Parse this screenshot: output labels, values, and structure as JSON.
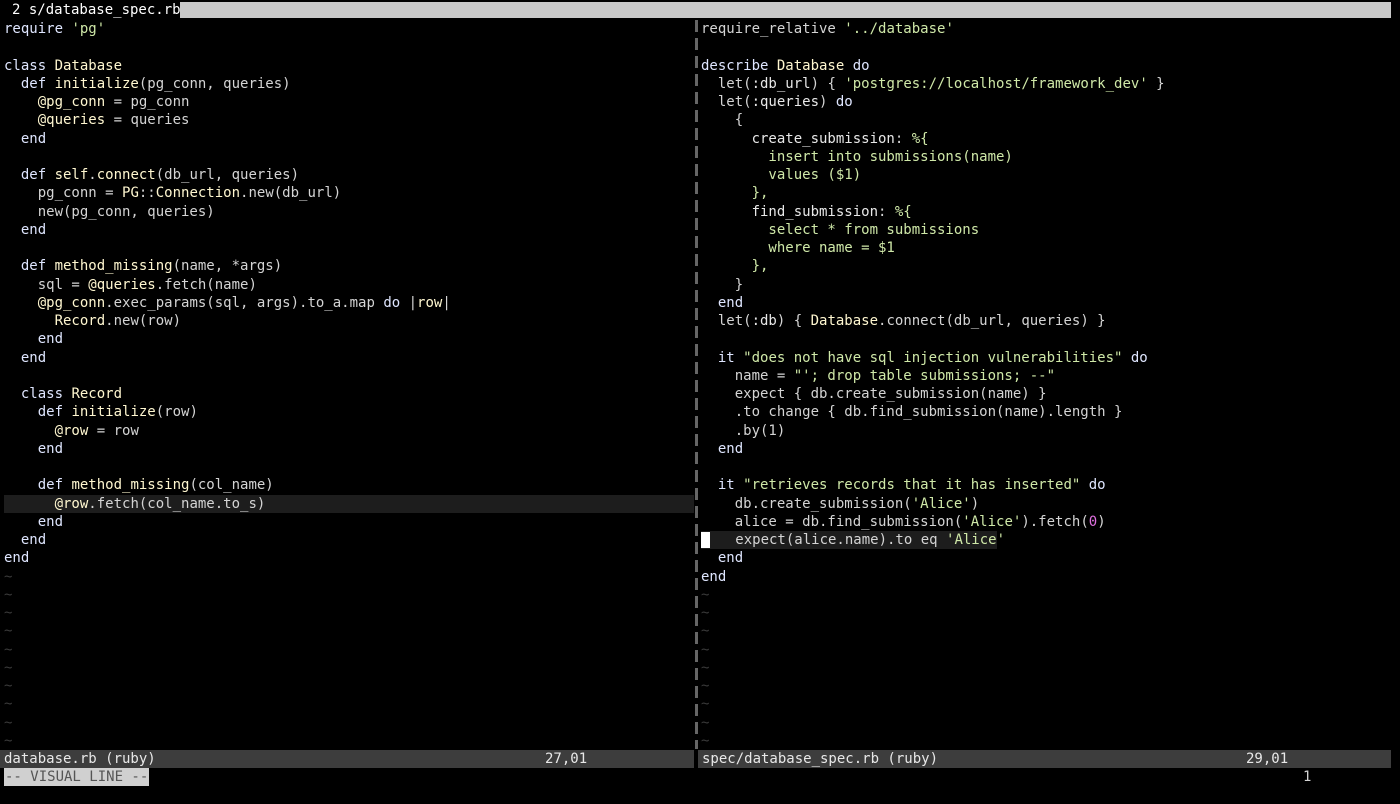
{
  "tabline": {
    "active_tab": "2 s/database_spec.rb"
  },
  "colors": {
    "background": "#000000",
    "text": "#d4d4d4",
    "keyword": "#dfe6ff",
    "name": "#fff7d0",
    "string": "#cfe8a8",
    "symbol": "#e8e8e8",
    "number": "#e070e0",
    "tilde": "#3a3a3a",
    "statusline": "#3d3d3d",
    "cursorline": "#1d1d1d"
  },
  "left_pane": {
    "lines": [
      [
        [
          "require ",
          "k"
        ],
        [
          "'pg'",
          "s"
        ]
      ],
      [],
      [
        [
          "class ",
          "k"
        ],
        [
          "Database",
          "n"
        ]
      ],
      [
        [
          "  def ",
          "k"
        ],
        [
          "initialize",
          "n"
        ],
        [
          "(pg_conn, queries)",
          "t"
        ]
      ],
      [
        [
          "    @pg_conn",
          "n"
        ],
        [
          " = pg_conn",
          "t"
        ]
      ],
      [
        [
          "    @queries",
          "n"
        ],
        [
          " = queries",
          "t"
        ]
      ],
      [
        [
          "  end",
          "k"
        ]
      ],
      [],
      [
        [
          "  def ",
          "k"
        ],
        [
          "self",
          "n"
        ],
        [
          ".",
          "t"
        ],
        [
          "connect",
          "n"
        ],
        [
          "(db_url, queries)",
          "t"
        ]
      ],
      [
        [
          "    pg_conn = ",
          "t"
        ],
        [
          "PG",
          "n"
        ],
        [
          "::",
          "t"
        ],
        [
          "Connection",
          "n"
        ],
        [
          ".new(db_url)",
          "t"
        ]
      ],
      [
        [
          "    new(pg_conn, queries)",
          "t"
        ]
      ],
      [
        [
          "  end",
          "k"
        ]
      ],
      [],
      [
        [
          "  def ",
          "k"
        ],
        [
          "method_missing",
          "n"
        ],
        [
          "(name, *args)",
          "t"
        ]
      ],
      [
        [
          "    sql = ",
          "t"
        ],
        [
          "@queries",
          "n"
        ],
        [
          ".fetch(name)",
          "t"
        ]
      ],
      [
        [
          "    @pg_conn",
          "n"
        ],
        [
          ".exec_params(sql, args).to_a.map ",
          "t"
        ],
        [
          "do",
          "k"
        ],
        [
          " |",
          "t"
        ],
        [
          "row",
          "n"
        ],
        [
          "|",
          "t"
        ]
      ],
      [
        [
          "      Record",
          "n"
        ],
        [
          ".new(row)",
          "t"
        ]
      ],
      [
        [
          "    end",
          "k"
        ]
      ],
      [
        [
          "  end",
          "k"
        ]
      ],
      [],
      [
        [
          "  class ",
          "k"
        ],
        [
          "Record",
          "n"
        ]
      ],
      [
        [
          "    def ",
          "k"
        ],
        [
          "initialize",
          "n"
        ],
        [
          "(row)",
          "t"
        ]
      ],
      [
        [
          "      @row",
          "n"
        ],
        [
          " = row",
          "t"
        ]
      ],
      [
        [
          "    end",
          "k"
        ]
      ],
      [],
      [
        [
          "    def ",
          "k"
        ],
        [
          "method_missing",
          "n"
        ],
        [
          "(col_name)",
          "t"
        ]
      ],
      [
        [
          "      @row",
          "n"
        ],
        [
          ".fetch(col_name.to_s)",
          "t"
        ]
      ],
      [
        [
          "    end",
          "k"
        ]
      ],
      [
        [
          "  end",
          "k"
        ]
      ],
      [
        [
          "end",
          "k"
        ]
      ]
    ],
    "cursorline_index": 26,
    "tilde_count": 10,
    "tilde": "~"
  },
  "right_pane": {
    "lines": [
      [
        [
          "require_relative ",
          "t"
        ],
        [
          "'../database'",
          "s"
        ]
      ],
      [],
      [
        [
          "describe ",
          "k"
        ],
        [
          "Database",
          "n"
        ],
        [
          " do",
          "k"
        ]
      ],
      [
        [
          "  let(",
          "t"
        ],
        [
          ":db_url",
          "y"
        ],
        [
          ") { ",
          "t"
        ],
        [
          "'postgres://localhost/framework_dev'",
          "s"
        ],
        [
          " }",
          "t"
        ]
      ],
      [
        [
          "  let(",
          "t"
        ],
        [
          ":queries",
          "y"
        ],
        [
          ") ",
          "t"
        ],
        [
          "do",
          "k"
        ]
      ],
      [
        [
          "    {",
          "t"
        ]
      ],
      [
        [
          "      create_submission",
          "y"
        ],
        [
          ": ",
          "t"
        ],
        [
          "%{",
          "s"
        ]
      ],
      [
        [
          "        insert into submissions(name)",
          "s"
        ]
      ],
      [
        [
          "        values ($1)",
          "s"
        ]
      ],
      [
        [
          "      },",
          "s"
        ]
      ],
      [
        [
          "      find_submission",
          "y"
        ],
        [
          ": ",
          "t"
        ],
        [
          "%{",
          "s"
        ]
      ],
      [
        [
          "        select * from submissions",
          "s"
        ]
      ],
      [
        [
          "        where name = $1",
          "s"
        ]
      ],
      [
        [
          "      },",
          "s"
        ]
      ],
      [
        [
          "    }",
          "t"
        ]
      ],
      [
        [
          "  end",
          "k"
        ]
      ],
      [
        [
          "  let(",
          "t"
        ],
        [
          ":db",
          "y"
        ],
        [
          ") { ",
          "t"
        ],
        [
          "Database",
          "n"
        ],
        [
          ".connect(db_url, queries) }",
          "t"
        ]
      ],
      [],
      [
        [
          "  it ",
          "k"
        ],
        [
          "\"does not have sql injection vulnerabilities\"",
          "s"
        ],
        [
          " do",
          "k"
        ]
      ],
      [
        [
          "    name = ",
          "t"
        ],
        [
          "\"'; drop table submissions; --\"",
          "s"
        ]
      ],
      [
        [
          "    expect { db.create_submission(name) }",
          "t"
        ]
      ],
      [
        [
          "    .to change { db.find_submission(name).length }",
          "t"
        ]
      ],
      [
        [
          "    .by(1)",
          "t"
        ]
      ],
      [
        [
          "  end",
          "k"
        ]
      ],
      [],
      [
        [
          "  it ",
          "k"
        ],
        [
          "\"retrieves records that it has inserted\"",
          "s"
        ],
        [
          " do",
          "k"
        ]
      ],
      [
        [
          "    db.create_submission(",
          "t"
        ],
        [
          "'Alice'",
          "s"
        ],
        [
          ")",
          "t"
        ]
      ],
      [
        [
          "    alice = db.find_submission(",
          "t"
        ],
        [
          "'Alice'",
          "s"
        ],
        [
          ").fetch(",
          "t"
        ],
        [
          "0",
          "m"
        ],
        [
          ")",
          "t"
        ]
      ],
      [
        [
          "    expect(alice.name).to eq ",
          "t"
        ],
        [
          "'Alice'",
          "s"
        ]
      ],
      [
        [
          "  end",
          "k"
        ]
      ],
      [
        [
          "end",
          "k"
        ]
      ]
    ],
    "cursorline_index": 28,
    "tilde_count": 9,
    "tilde": "~"
  },
  "status": {
    "left_file": "database.rb (ruby)",
    "left_pos": "27,01",
    "right_file": "spec/database_spec.rb (ruby)",
    "right_pos": "29,01"
  },
  "mode_text": "-- VISUAL LINE --",
  "ruler_count": "1"
}
